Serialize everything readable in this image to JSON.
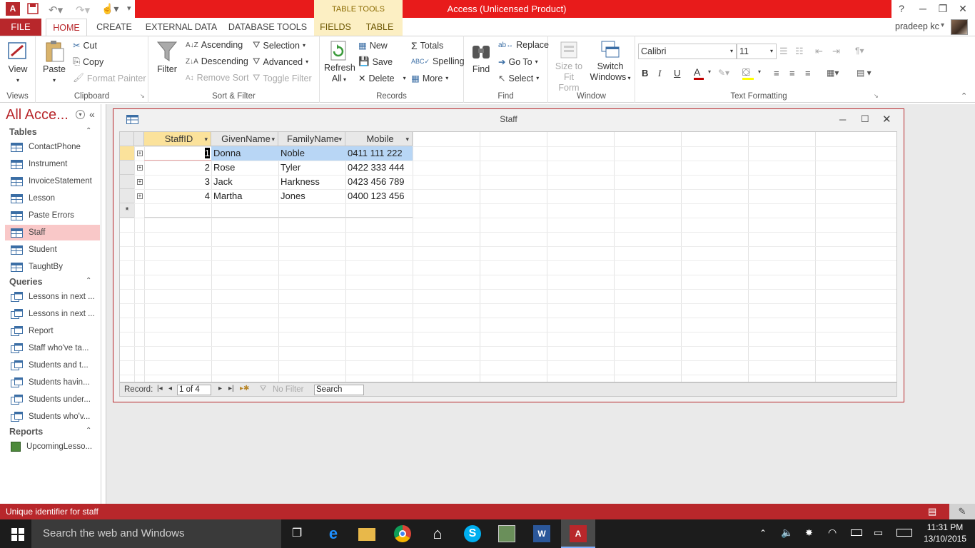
{
  "title_bar": {
    "app_title": "Access (Unlicensed Product)",
    "context_tab_group": "TABLE TOOLS",
    "help": "?",
    "user": "pradeep kc"
  },
  "ribbon_tabs": {
    "file": "FILE",
    "items": [
      "HOME",
      "CREATE",
      "EXTERNAL DATA",
      "DATABASE TOOLS"
    ],
    "context_items": [
      "FIELDS",
      "TABLE"
    ],
    "active": "HOME"
  },
  "ribbon": {
    "views": {
      "label": "Views",
      "view": "View"
    },
    "clipboard": {
      "label": "Clipboard",
      "paste": "Paste",
      "cut": "Cut",
      "copy": "Copy",
      "format_painter": "Format Painter"
    },
    "sort_filter": {
      "label": "Sort & Filter",
      "filter": "Filter",
      "ascending": "Ascending",
      "descending": "Descending",
      "remove_sort": "Remove Sort",
      "selection": "Selection",
      "advanced": "Advanced",
      "toggle_filter": "Toggle Filter"
    },
    "records": {
      "label": "Records",
      "refresh": "Refresh",
      "refresh_all": "All",
      "new": "New",
      "save": "Save",
      "delete": "Delete",
      "totals": "Totals",
      "spelling": "Spelling",
      "more": "More"
    },
    "find": {
      "label": "Find",
      "find": "Find",
      "replace": "Replace",
      "go_to": "Go To",
      "select": "Select"
    },
    "window": {
      "label": "Window",
      "size_to": "Size to",
      "fit_form": "Fit Form",
      "switch": "Switch",
      "windows": "Windows"
    },
    "text_formatting": {
      "label": "Text Formatting",
      "font": "Calibri",
      "size": "11",
      "bold": "B",
      "italic": "I",
      "underline": "U",
      "font_color": "#c00000",
      "highlight_color": "#ffff00"
    }
  },
  "nav_pane": {
    "title": "All Acce...",
    "sections": {
      "tables": {
        "label": "Tables",
        "items": [
          "ContactPhone",
          "Instrument",
          "InvoiceStatement",
          "Lesson",
          "Paste Errors",
          "Staff",
          "Student",
          "TaughtBy"
        ]
      },
      "queries": {
        "label": "Queries",
        "items": [
          "Lessons in next ...",
          "Lessons in next ...",
          "Report",
          "Staff who've ta...",
          "Students and t...",
          "Students havin...",
          "Students under...",
          "Students who'v..."
        ]
      },
      "reports": {
        "label": "Reports",
        "items": [
          "UpcomingLesso..."
        ]
      }
    },
    "selected": "Staff"
  },
  "datasheet": {
    "window_title": "Staff",
    "columns": [
      "StaffID",
      "GivenName",
      "FamilyName",
      "Mobile"
    ],
    "rows": [
      [
        "1",
        "Donna",
        "Noble",
        "0411 111 222"
      ],
      [
        "2",
        "Rose",
        "Tyler",
        "0422 333 444"
      ],
      [
        "3",
        "Jack",
        "Harkness",
        "0423 456 789"
      ],
      [
        "4",
        "Martha",
        "Jones",
        "0400 123 456"
      ]
    ],
    "new_record_marker": "*"
  },
  "record_nav": {
    "label": "Record:",
    "position": "1 of 4",
    "no_filter": "No Filter",
    "search": "Search"
  },
  "status_bar": {
    "text": "Unique identifier for staff"
  },
  "taskbar": {
    "search_placeholder": "Search the web and Windows",
    "time": "11:31 PM",
    "date": "13/10/2015"
  },
  "colors": {
    "accent": "#b8272b",
    "title_red": "#e81b1b",
    "context_tab": "#fcefc3",
    "selected_header": "#fbe29b",
    "nav_selected": "#f9c8c8"
  }
}
